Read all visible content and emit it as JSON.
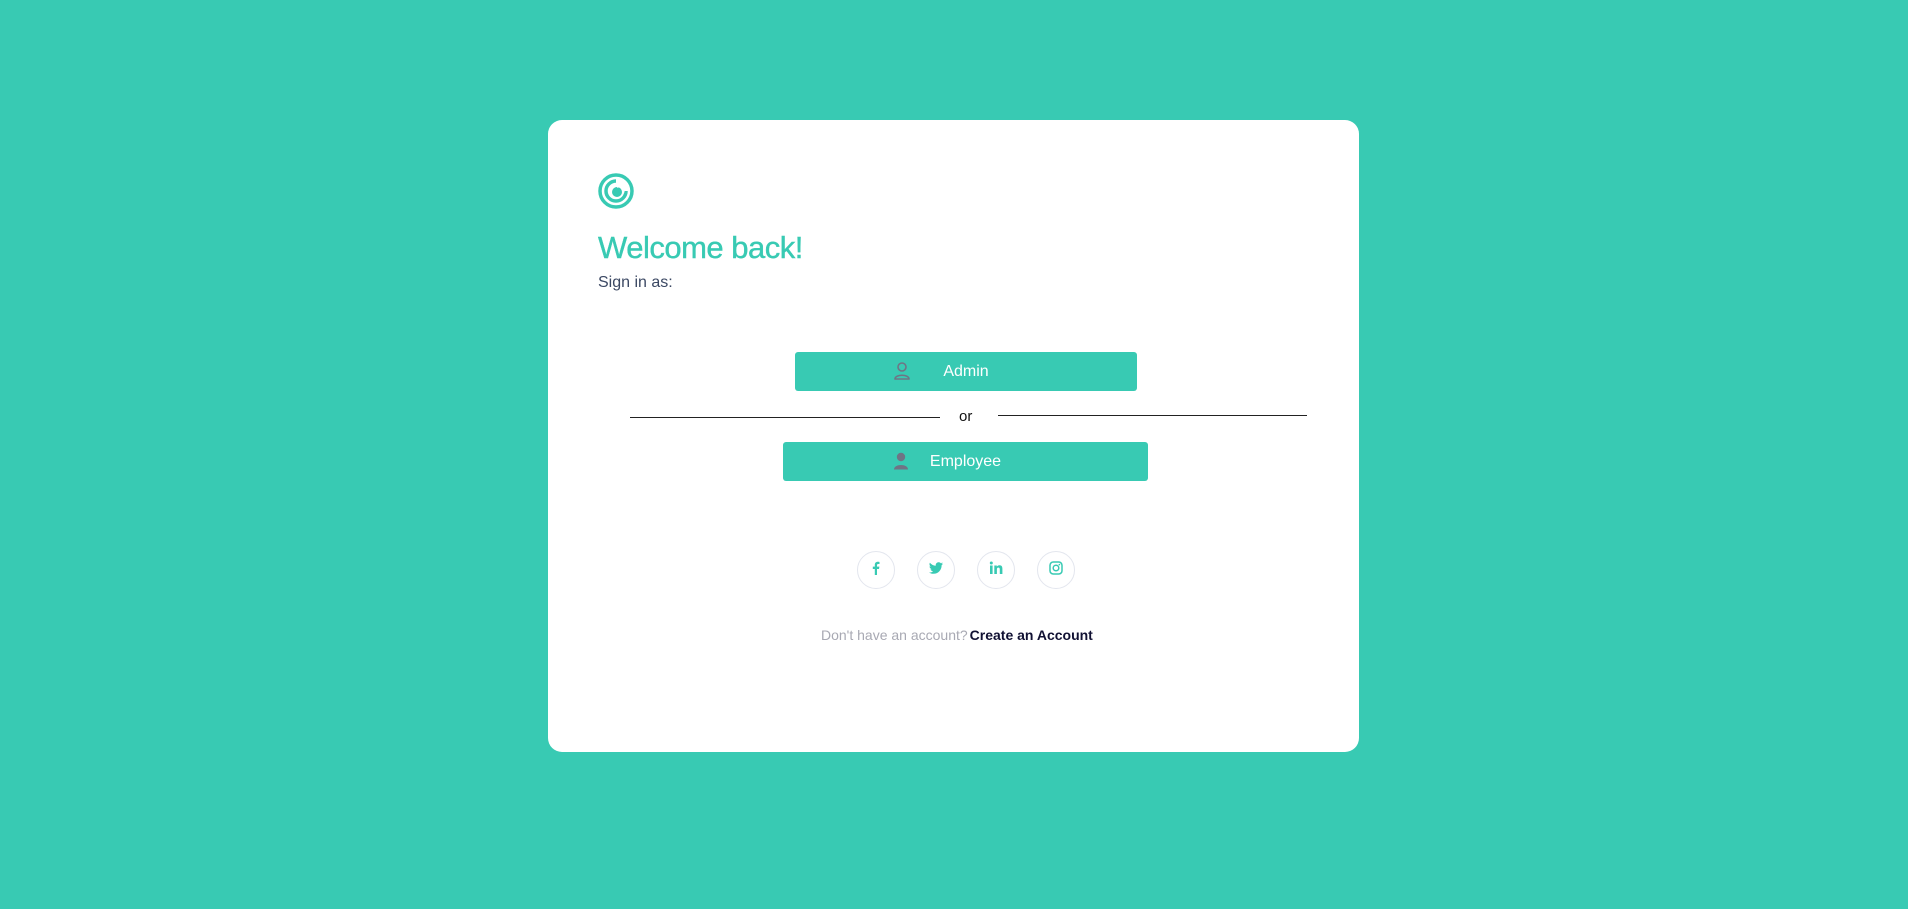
{
  "colors": {
    "background": "#38cab3",
    "card": "#ffffff",
    "accent": "#38cab3",
    "icon_gray": "#6f7485"
  },
  "header": {
    "logo_icon": "spiral-logo-icon",
    "title": "Welcome back!",
    "subtitle": "Sign in as:"
  },
  "roles": {
    "admin": {
      "label": "Admin",
      "icon": "user-outline-icon"
    },
    "divider_text": "or",
    "employee": {
      "label": "Employee",
      "icon": "user-filled-icon"
    }
  },
  "social": [
    {
      "name": "facebook",
      "icon": "facebook-icon"
    },
    {
      "name": "twitter",
      "icon": "twitter-icon"
    },
    {
      "name": "linkedin",
      "icon": "linkedin-icon"
    },
    {
      "name": "instagram",
      "icon": "instagram-icon"
    }
  ],
  "footer": {
    "prompt": "Don't have an account?",
    "link_label": "Create an Account"
  }
}
